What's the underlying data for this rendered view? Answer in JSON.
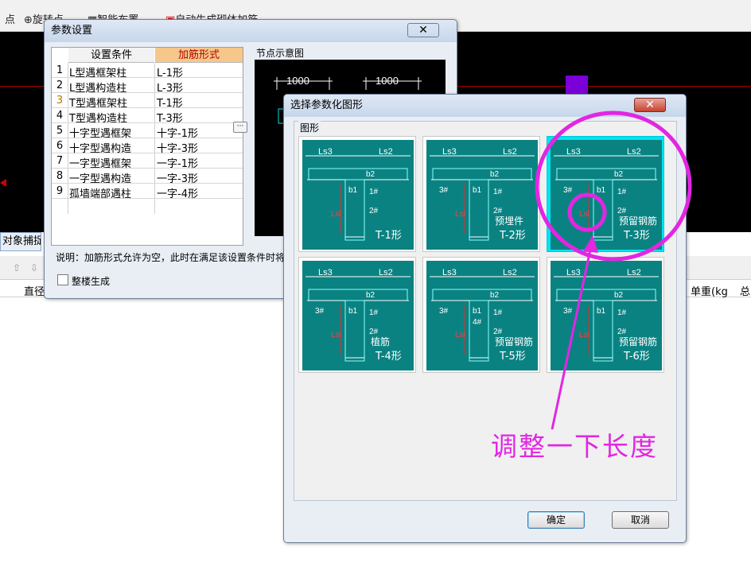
{
  "toolbar": {
    "items": [
      "点",
      "旋转点",
      "智能布置",
      "自动生成砌体加筋"
    ]
  },
  "snap_label": "对象捕捉",
  "grid_header": {
    "col1": "直径",
    "col2": "单重(kg",
    "col3": "总"
  },
  "params_dialog": {
    "title": "参数设置",
    "close": "✕",
    "header_cond": "设置条件",
    "header_form": "加筋形式",
    "rows": [
      {
        "num": "1",
        "cond": "L型遇框架柱",
        "form": "L-1形"
      },
      {
        "num": "2",
        "cond": "L型遇构造柱",
        "form": "L-3形"
      },
      {
        "num": "3",
        "cond": "T型遇框架柱",
        "form": "T-1形"
      },
      {
        "num": "4",
        "cond": "T型遇构造柱",
        "form": "T-3形"
      },
      {
        "num": "5",
        "cond": "十字型遇框架",
        "form": "十字-1形"
      },
      {
        "num": "6",
        "cond": "十字型遇构造",
        "form": "十字-3形"
      },
      {
        "num": "7",
        "cond": "一字型遇框架",
        "form": "一字-1形"
      },
      {
        "num": "8",
        "cond": "一字型遇构造",
        "form": "一字-3形"
      },
      {
        "num": "9",
        "cond": "孤墙端部遇柱",
        "form": "一字-4形"
      }
    ],
    "ellipsis": "···",
    "node_label": "节点示意图",
    "dim1": "1000",
    "dim2": "1000",
    "note": "说明：加筋形式允许为空，此时在满足该设置条件时将",
    "whole_label": "整楼生成"
  },
  "select_dialog": {
    "title": "选择参数化图形",
    "close": "✕",
    "group_label": "图形",
    "tiles": [
      {
        "name": "T-1形",
        "sub": "",
        "ls3": "Ls3",
        "ls2": "Ls2",
        "b1": "b1",
        "b2": "b2",
        "lsl": "Lsl",
        "bar1": "1#",
        "bar2": "2#",
        "bar3": ""
      },
      {
        "name": "T-2形",
        "sub": "预埋件",
        "ls3": "Ls3",
        "ls2": "Ls2",
        "b1": "b1",
        "b2": "b2",
        "lsl": "Lsl",
        "bar1": "1#",
        "bar2": "2#",
        "bar3": "3#"
      },
      {
        "name": "T-3形",
        "sub": "预留钢筋",
        "ls3": "Ls3",
        "ls2": "Ls2",
        "b1": "b1",
        "b2": "b2",
        "lsl": "Lsl",
        "bar1": "1#",
        "bar2": "2#",
        "bar3": "3#"
      },
      {
        "name": "T-4形",
        "sub": "植筋",
        "ls3": "Ls3",
        "ls2": "Ls2",
        "b1": "b1",
        "b2": "b2",
        "lsl": "Lsl",
        "bar1": "1#",
        "bar2": "2#",
        "bar3": "3#"
      },
      {
        "name": "T-5形",
        "sub": "预留钢筋",
        "ls3": "Ls3",
        "ls2": "Ls2",
        "b1": "b1",
        "b2": "b2",
        "lsl": "Lsl",
        "bar1": "1#",
        "bar2": "2#",
        "bar3": "3#",
        "bar4": "4#"
      },
      {
        "name": "T-6形",
        "sub": "预留钢筋",
        "ls3": "Ls3",
        "ls2": "Ls2",
        "b1": "b1",
        "b2": "b2",
        "lsl": "Lsl",
        "bar1": "1#",
        "bar2": "2#",
        "bar3": "3#"
      }
    ],
    "selected_index": 2,
    "ok": "确定",
    "cancel": "取消"
  },
  "annotation": {
    "text": "调整一下长度",
    "color": "#e226e2"
  },
  "colors": {
    "tile_bg": "#0b8282",
    "selected_border": "#00e4f0",
    "header_form_bg": "#f6c78a"
  }
}
